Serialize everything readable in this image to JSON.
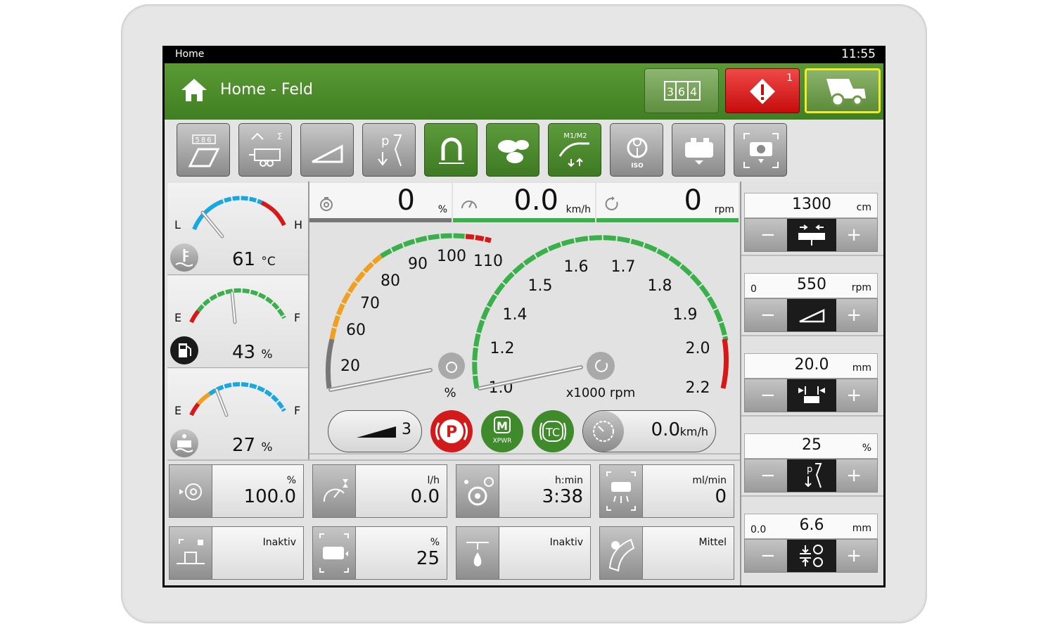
{
  "statusbar": {
    "screen": "Home",
    "time": "11:55"
  },
  "header": {
    "title": "Home - Feld",
    "alarm_count": "1",
    "counter_digits": [
      "3",
      "6",
      "4"
    ]
  },
  "toolbar": {
    "items": [
      {
        "name": "counter",
        "label": "586"
      },
      {
        "name": "harvest-sum"
      },
      {
        "name": "ramp"
      },
      {
        "name": "pressure-control",
        "label": "p"
      },
      {
        "name": "magnet",
        "active": true
      },
      {
        "name": "stones",
        "active": true
      },
      {
        "name": "m1-m2-mode",
        "label": "M1/M2",
        "active": true
      },
      {
        "name": "iso",
        "label": "ISO"
      },
      {
        "name": "tank"
      },
      {
        "name": "tank-camera"
      }
    ]
  },
  "left_gauges": {
    "temp": {
      "low": "L",
      "high": "H",
      "value": "61",
      "unit": "°C"
    },
    "fuel": {
      "low": "E",
      "high": "F",
      "value": "43",
      "unit": "%"
    },
    "def": {
      "low": "E",
      "high": "F",
      "value": "27",
      "unit": "%"
    }
  },
  "topbar": {
    "load": {
      "value": "0",
      "unit": "%"
    },
    "speed": {
      "value": "0.0",
      "unit": "km/h"
    },
    "rpm": {
      "value": "0",
      "unit": "rpm"
    }
  },
  "big_gauges": {
    "load": {
      "ticks": [
        "20",
        "60",
        "70",
        "80",
        "90",
        "100",
        "110"
      ],
      "unit": "%"
    },
    "rpm": {
      "ticks": [
        "1.0",
        "1.2",
        "1.4",
        "1.5",
        "1.6",
        "1.7",
        "1.8",
        "1.9",
        "2.0",
        "2.2"
      ],
      "unit": "x1000 rpm"
    }
  },
  "status_row": {
    "gear": "3",
    "park": "P",
    "xpwr": "XPWR",
    "tc": "TC",
    "cruise_speed": "0.0",
    "cruise_unit": "km/h"
  },
  "tiles_row1": [
    {
      "unit": "%",
      "value": "100.0"
    },
    {
      "unit": "l/h",
      "value": "0.0"
    },
    {
      "unit": "h:min",
      "value": "3:38"
    },
    {
      "unit": "ml/min",
      "value": "0"
    }
  ],
  "tiles_row2": [
    {
      "status": "Inaktiv"
    },
    {
      "unit": "%",
      "value": "25"
    },
    {
      "status": "Inaktiv"
    },
    {
      "status": "Mittel"
    }
  ],
  "right_controls": [
    {
      "left": "",
      "value": "1300",
      "unit": "cm"
    },
    {
      "left": "0",
      "value": "550",
      "unit": "rpm"
    },
    {
      "left": "",
      "value": "20.0",
      "unit": "mm"
    },
    {
      "left": "",
      "value": "25",
      "unit": "%"
    },
    {
      "left": "0.0",
      "value": "6.6",
      "unit": "mm"
    }
  ],
  "colors": {
    "green": "#4a8a2a",
    "alarm_red": "#d81818",
    "accent_yellow": "#f0ea2a",
    "gauge_blue": "#17a8e2",
    "gauge_orange": "#f0a020",
    "gauge_green": "#3ab04a"
  },
  "control_signs": {
    "minus": "−",
    "plus": "+"
  }
}
